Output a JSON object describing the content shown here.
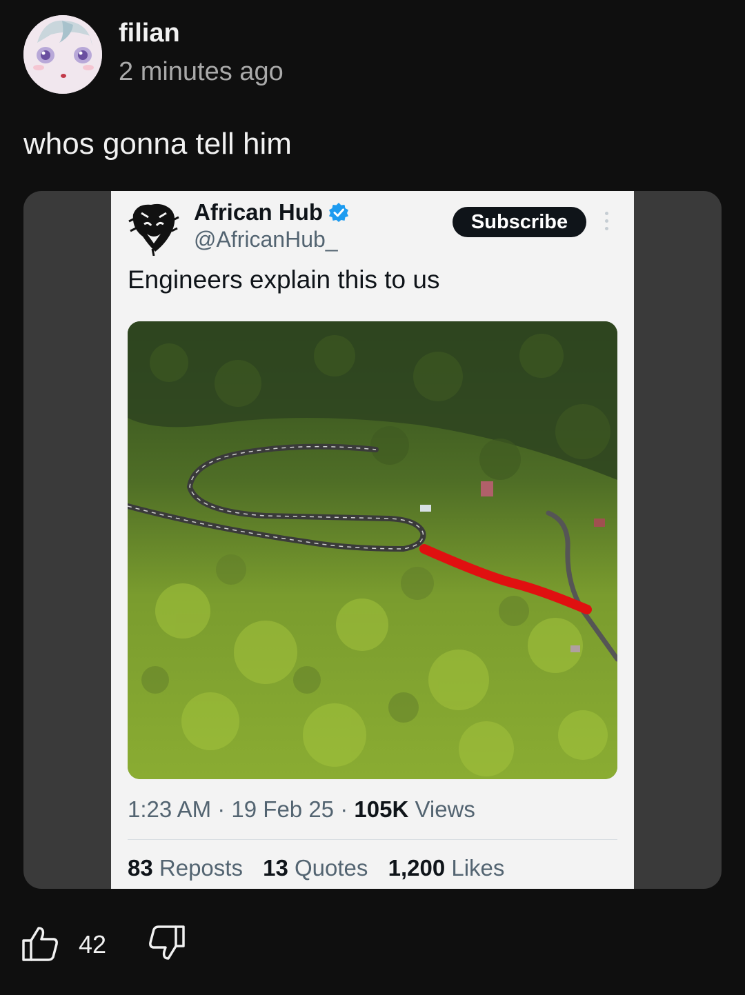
{
  "comment": {
    "username": "filian",
    "time": "2 minutes ago",
    "text": "whos gonna tell him"
  },
  "embedded_tweet": {
    "name": "African Hub",
    "handle": "@AfricanHub_",
    "subscribe_label": "Subscribe",
    "text": "Engineers explain this to us",
    "time": "1:23 AM",
    "date": "19 Feb 25",
    "views_count": "105K",
    "views_label": "Views",
    "reposts_count": "83",
    "reposts_label": "Reposts",
    "quotes_count": "13",
    "quotes_label": "Quotes",
    "likes_count": "1,200",
    "likes_label": "Likes",
    "separator": "·"
  },
  "actions": {
    "like_count": "42",
    "like_icon": "thumbs-up-icon",
    "dislike_icon": "thumbs-down-icon"
  },
  "colors": {
    "background": "#0f0f0f",
    "frame": "#3a3a3a",
    "tweet_bg": "#f3f3f3",
    "verified": "#1d9bf0",
    "highlight": "#e01010"
  }
}
